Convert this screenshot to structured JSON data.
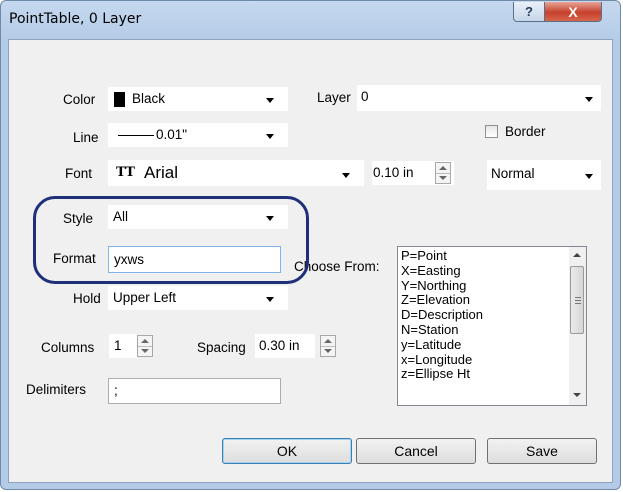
{
  "window": {
    "title": "PointTable, 0 Layer",
    "help_label": "?",
    "close_label": "X"
  },
  "form": {
    "color": {
      "label": "Color",
      "value": "Black",
      "swatch": "#000000"
    },
    "layer": {
      "label": "Layer",
      "value": "0"
    },
    "line": {
      "label": "Line",
      "value": "0.01\""
    },
    "border": {
      "label": "Border",
      "checked": false
    },
    "font": {
      "label": "Font",
      "icon": "TT",
      "value": "Arial",
      "size": "0.10 in",
      "weight": "Normal"
    },
    "style": {
      "label": "Style",
      "value": "All"
    },
    "format": {
      "label": "Format",
      "value": "yxws"
    },
    "choose_from": {
      "label": "Choose From:",
      "items": [
        "P=Point",
        "X=Easting",
        "Y=Northing",
        "Z=Elevation",
        "D=Description",
        "N=Station",
        "y=Latitude",
        "x=Longitude",
        "z=Ellipse Ht"
      ]
    },
    "hold": {
      "label": "Hold",
      "value": "Upper Left"
    },
    "columns": {
      "label": "Columns",
      "value": "1"
    },
    "spacing": {
      "label": "Spacing",
      "value": "0.30 in"
    },
    "delimiters": {
      "label": "Delimiters",
      "value": ";"
    }
  },
  "buttons": {
    "ok": "OK",
    "cancel": "Cancel",
    "save": "Save"
  },
  "colors": {
    "highlight": "#1f2f7a",
    "close": "#c5412c"
  }
}
